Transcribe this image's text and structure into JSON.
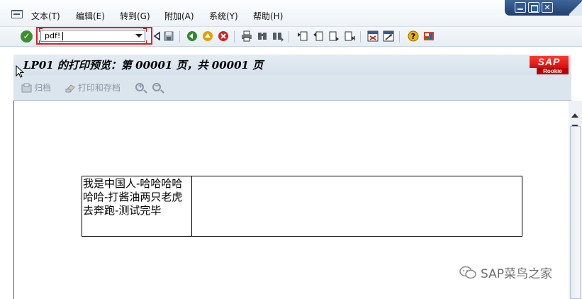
{
  "menubar": {
    "items": [
      {
        "label": "文本(T)"
      },
      {
        "label": "编辑(E)"
      },
      {
        "label": "转到(G)"
      },
      {
        "label": "附加(A)"
      },
      {
        "label": "系统(Y)"
      },
      {
        "label": "帮助(H)"
      }
    ]
  },
  "window_controls": {
    "close_symbol": "✕"
  },
  "toolbar": {
    "command_field_value": "pdf!",
    "highlight_color": "#e02020"
  },
  "titlebar": {
    "title": "LP01 的打印预览：第 00001 页，共 00001  页"
  },
  "sap_logo": {
    "main": "SAP",
    "sub": "Rookie"
  },
  "app_toolbar": {
    "archive_label": "归档",
    "print_archive_label": "打印和存档",
    "zoom_in_symbol": "+",
    "zoom_out_symbol": "−"
  },
  "preview": {
    "form_text": "我是中国人-哈哈哈哈哈哈-打酱油两只老虎去奔跑-测试完毕"
  },
  "watermark": {
    "text": "SAP菜鸟之家"
  }
}
